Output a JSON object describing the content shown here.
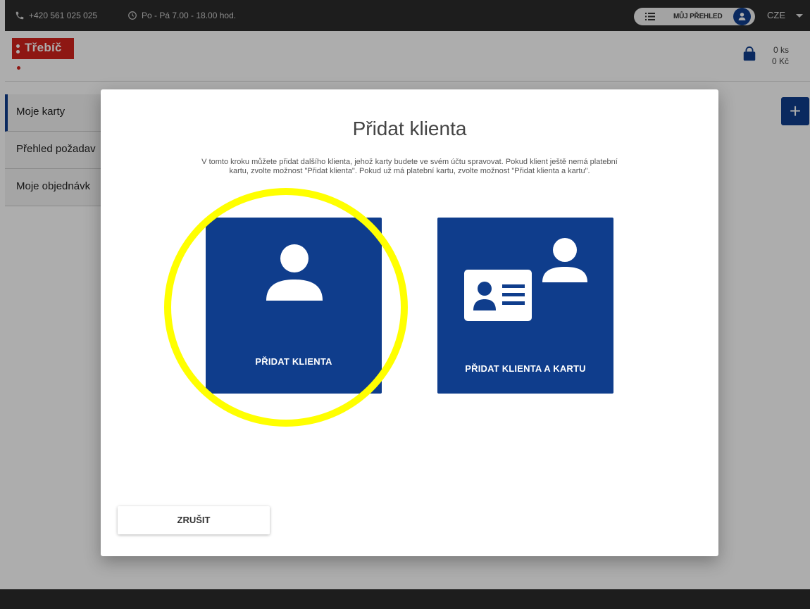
{
  "topbar": {
    "phone": "+420 561 025 025",
    "hours": "Po - Pá 7.00 - 18.00 hod.",
    "overview_label": "MŮJ PŘEHLED",
    "language": "CZE"
  },
  "header": {
    "logo_text": "Třebíč",
    "cart_count": "0 ks",
    "cart_total": "0 Kč"
  },
  "sidenav": {
    "items": [
      {
        "label": "Moje karty"
      },
      {
        "label": "Přehled požadav"
      },
      {
        "label": "Moje objednávk"
      }
    ]
  },
  "fab_icon": "plus-icon",
  "modal": {
    "title": "Přidat klienta",
    "description": "V tomto kroku můžete přidat dalšího klienta, jehož karty budete ve svém účtu spravovat. Pokud klient ještě nemá platební kartu, zvolte možnost \"Přidat klienta\". Pokud už má platební kartu, zvolte možnost \"Přidat klienta a kartu\".",
    "options": [
      {
        "label": "PŘIDAT KLIENTA",
        "icon": "person-icon"
      },
      {
        "label": "PŘIDAT KLIENTA A KARTU",
        "icon": "id-card-person-icon"
      }
    ],
    "cancel_label": "ZRUŠIT"
  },
  "colors": {
    "brand_blue": "#0f3d8c",
    "brand_red": "#d2221c",
    "highlight": "#ffff00",
    "topbar": "#2b2b2b"
  }
}
